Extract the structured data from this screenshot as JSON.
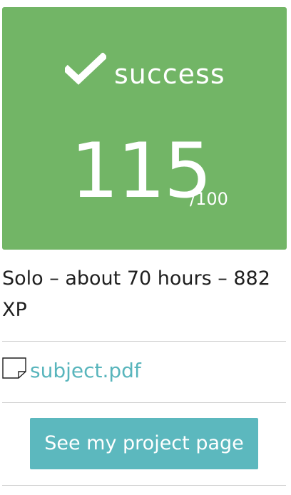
{
  "result": {
    "status": "success",
    "score": "115",
    "max_score": "/100",
    "colors": {
      "success_bg": "#72b566",
      "text_on_success": "#ffffff"
    }
  },
  "project": {
    "info": "Solo – about 70 hours – 882 XP"
  },
  "attachment": {
    "label": "subject.pdf",
    "icon": "document-icon",
    "link_color": "#58b5bc"
  },
  "actions": {
    "project_page_label": "See my project page",
    "button_color": "#5cb8be"
  }
}
